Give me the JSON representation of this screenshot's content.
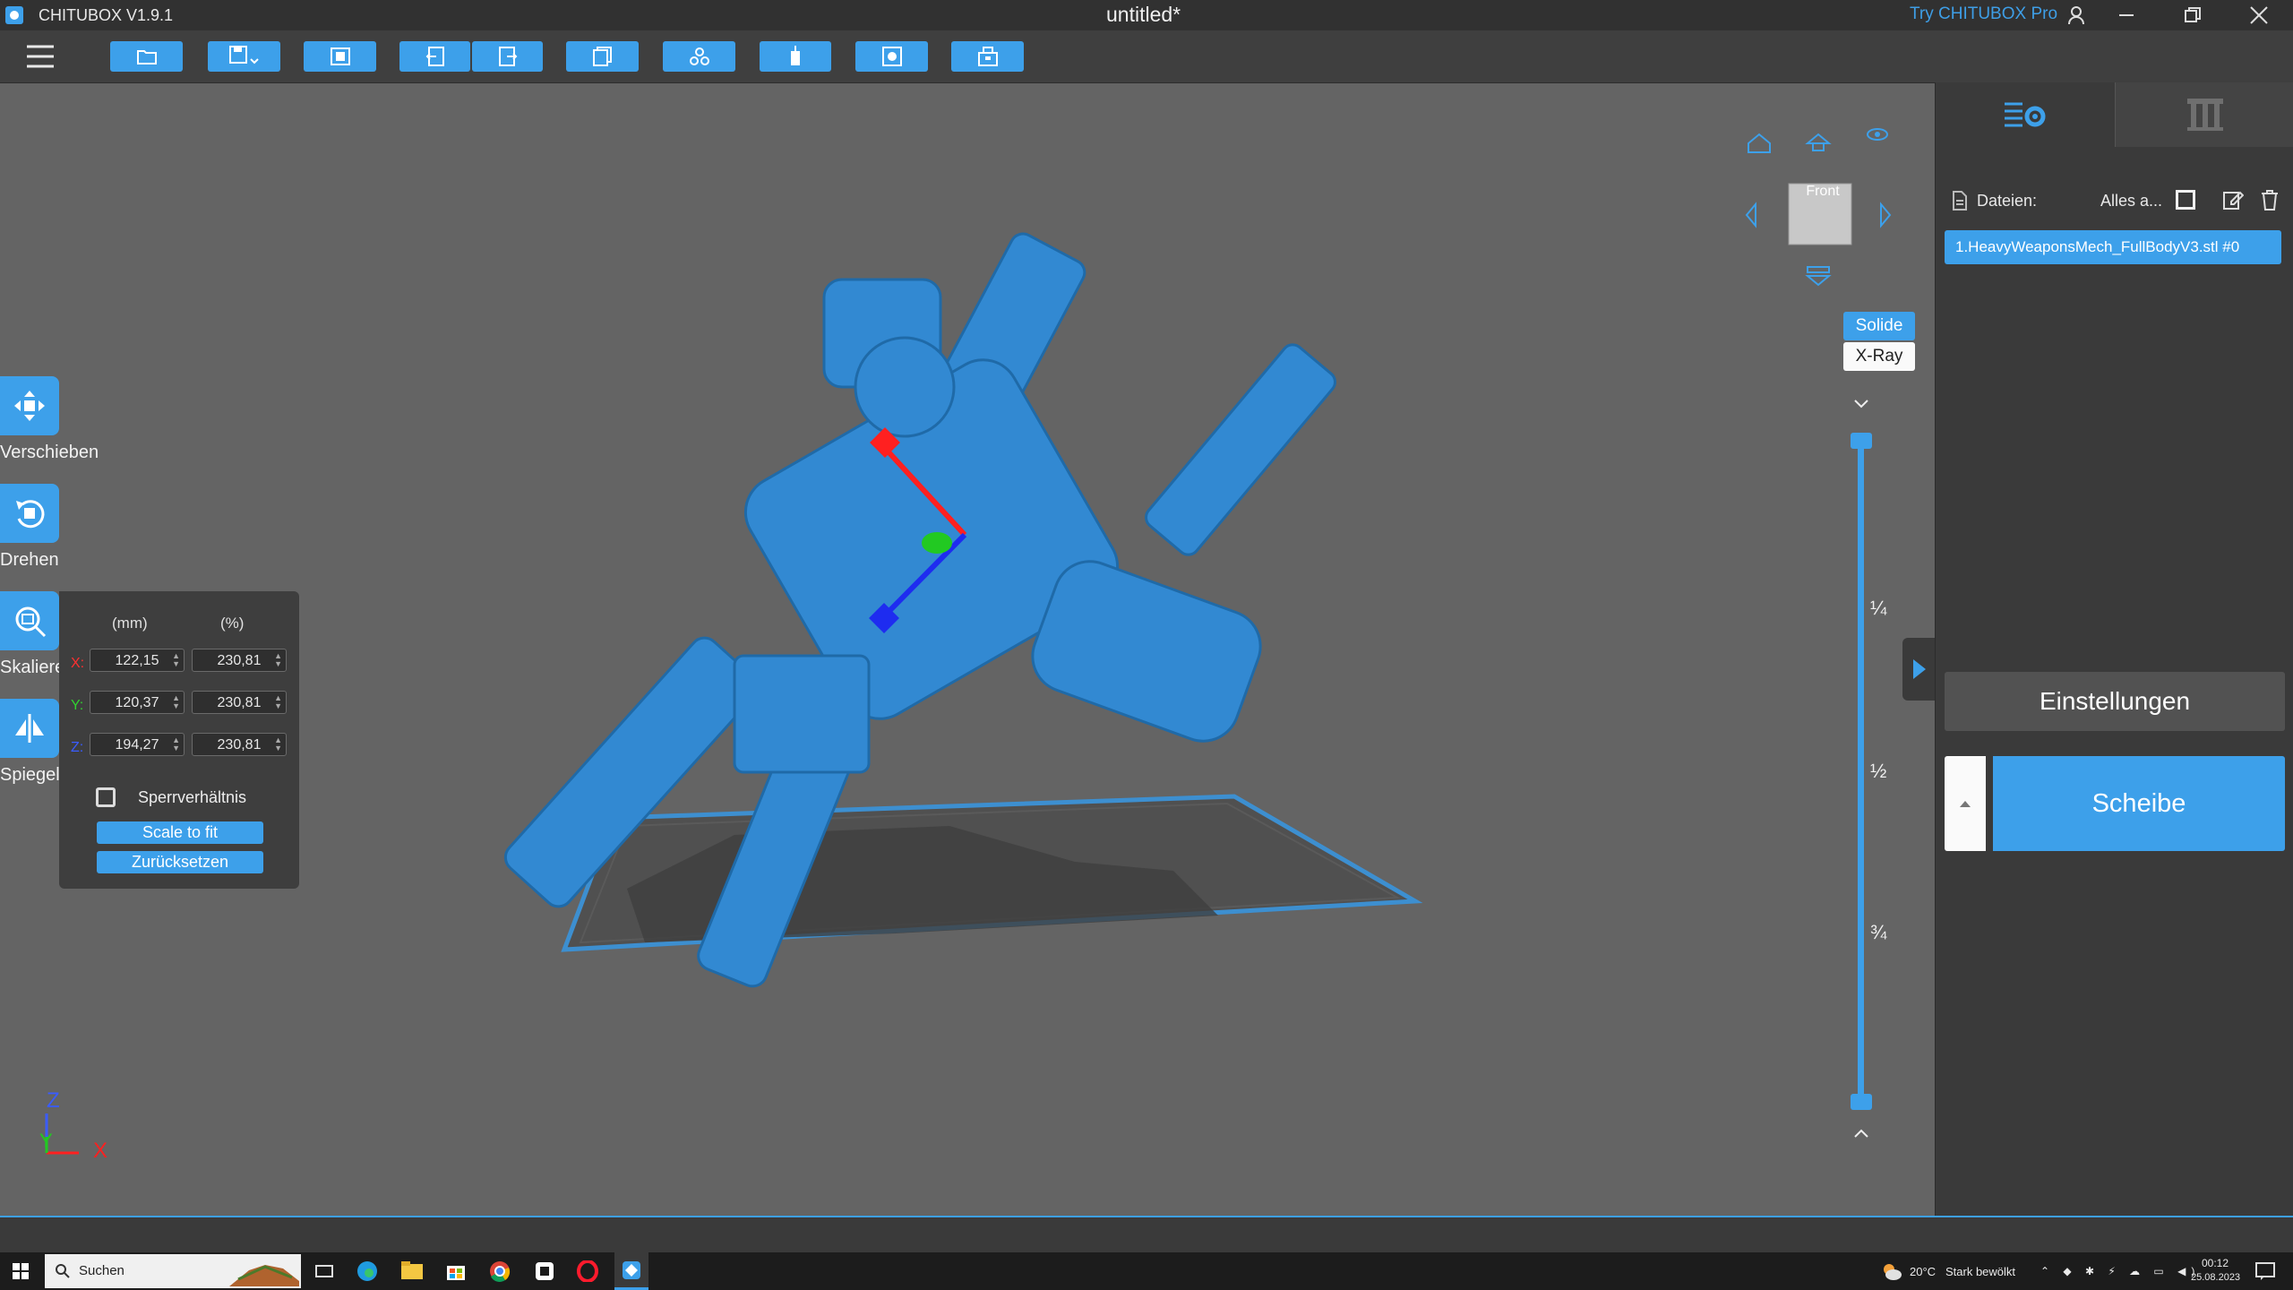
{
  "titlebar": {
    "app_title": "CHITUBOX V1.9.1",
    "document_title": "untitled*",
    "try_pro": "Try CHITUBOX Pro"
  },
  "toolbar": {
    "buttons": [
      "open-file-icon",
      "save-icon",
      "auto-layout-icon",
      "undo-icon",
      "redo-icon",
      "copy-icon",
      "arrange-icon",
      "support-icon",
      "hollow-icon",
      "print-icon"
    ]
  },
  "view_cube": {
    "face_label": "Front"
  },
  "view_mode": {
    "solid": "Solide",
    "xray": "X-Ray"
  },
  "slider": {
    "q1": "¼",
    "q2": "½",
    "q3": "¾"
  },
  "tools": {
    "move": "Verschieben",
    "rotate": "Drehen",
    "scale": "Skaliere",
    "mirror": "Spiegel"
  },
  "scale_panel": {
    "col_mm": "(mm)",
    "col_pct": "(%)",
    "x_label": "X:",
    "y_label": "Y:",
    "z_label": "Z:",
    "x_mm": "122,15",
    "x_pct": "230,81",
    "y_mm": "120,37",
    "y_pct": "230,81",
    "z_mm": "194,27",
    "z_pct": "230,81",
    "lock_label": "Sperrverhältnis",
    "scale_to_fit": "Scale to fit",
    "reset": "Zurücksetzen"
  },
  "axes": {
    "z": "Z",
    "y": "Y",
    "x": "X"
  },
  "right_panel": {
    "files_label": "Dateien:",
    "select_all": "Alles a...",
    "file_item": "1.HeavyWeaponsMech_FullBodyV3.stl #0",
    "settings": "Einstellungen",
    "slice": "Scheibe"
  },
  "taskbar": {
    "search": "Suchen",
    "temp": "20°C",
    "weather": "Stark bewölkt",
    "time": "00:12",
    "date": "25.08.2023"
  },
  "colors": {
    "accent": "#3da0ea",
    "x_axis": "#ff2020",
    "y_axis": "#22c922",
    "z_axis": "#1e2cf0"
  }
}
